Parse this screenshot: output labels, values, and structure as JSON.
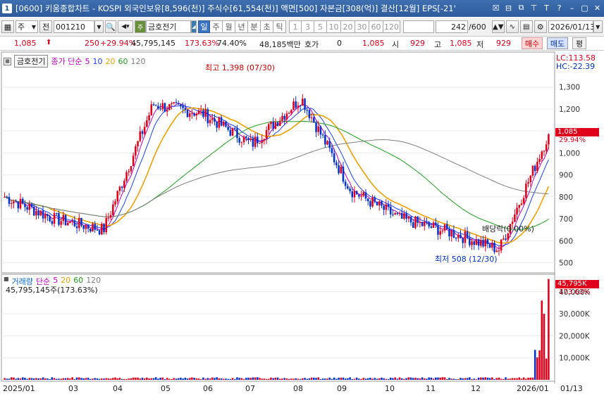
{
  "window": {
    "badge": "1",
    "title": "[0600] 키움종합차트 - KOSPI 외국인보유[8,596(천)] 주식수[61,554(천)] 액면[500] 자본금[308(억)] 결산[12월] EPS[-21'",
    "buttons": [
      "☒",
      "⊟",
      "⧉",
      "⊤",
      "T",
      "?",
      "–",
      "▢",
      "✕"
    ]
  },
  "toolbar": {
    "market_label": "주",
    "prev_label": "전",
    "code_value": "001210",
    "stock_name": "금호전기",
    "periods": [
      "일",
      "주",
      "월",
      "년",
      "분",
      "초",
      "틱"
    ],
    "active_period": "일",
    "intervals": [
      "1",
      "3",
      "5",
      "10",
      "20",
      "30",
      "60",
      "120"
    ],
    "count_value": "242",
    "count_total": "/600",
    "date_value": "2026/01/13"
  },
  "pricebar": {
    "price": "1,085",
    "change": "250",
    "change_pct": "+29.94%",
    "volume": "45,795,145",
    "volume_pct": "173.63%",
    "ratio": "74.40%",
    "amount": "48,185백만",
    "hoga_label": "호가",
    "hoga_value": "0",
    "ask": "1,085",
    "open_label": "시",
    "open_value": "929",
    "high_label": "고",
    "high_value": "1,085",
    "low_label": "저",
    "low_value": "929",
    "buy_label": "매수",
    "sell_label": "매도",
    "eval_label": "평"
  },
  "legend": {
    "stock": "금호전기",
    "ma_label": "종가 단순",
    "ma_periods": [
      "5",
      "10",
      "20",
      "60",
      "120"
    ],
    "ma_colors": [
      "#c000c0",
      "#2040ff",
      "#f0a000",
      "#20a020",
      "#808080"
    ]
  },
  "volume_legend": {
    "title": "거래량",
    "ma_label": "단순",
    "ma_periods": [
      "5",
      "20",
      "60",
      "120"
    ],
    "value_text": "45,795,145주(173.63%)"
  },
  "annotations": {
    "high_text": "최고 1,398 (07/30)",
    "low_text": "최저 508 (12/30)",
    "dividend_text": "배당락(0.00%)"
  },
  "right_axis": {
    "lc": "LC:113.58",
    "hc": "HC:-22.39",
    "price_ticks": [
      "1,300",
      "1,200",
      "1,100",
      "1,000",
      "900",
      "800",
      "700",
      "600",
      "500"
    ],
    "current_price": "1,085",
    "current_pct": "29.94%",
    "volume_ticks": [
      "40,000K",
      "30,000K",
      "20,000K",
      "10,000K"
    ],
    "current_volume": "45,795K",
    "current_volume_pct": "173.63%"
  },
  "x_axis": {
    "labels": [
      "2025/01",
      "03",
      "04",
      "05",
      "06",
      "07",
      "08",
      "09",
      "10",
      "11",
      "12",
      "2026/01",
      "01/13"
    ]
  },
  "chart_data": {
    "type": "candlestick",
    "ylim": [
      460,
      1440
    ],
    "volume_ylim": [
      0,
      46000000
    ],
    "x": [
      "2025/01",
      "2025/03",
      "2025/04",
      "2025/05",
      "2025/06",
      "2025/07",
      "2025/08",
      "2025/09",
      "2025/10",
      "2025/11",
      "2025/12",
      "2026/01"
    ],
    "close_monthly_approx": [
      800,
      700,
      650,
      1220,
      1180,
      1040,
      1250,
      830,
      700,
      640,
      560,
      1085
    ],
    "high": 1398,
    "low": 508,
    "last_close": 1085,
    "last_volume": 45795145
  }
}
